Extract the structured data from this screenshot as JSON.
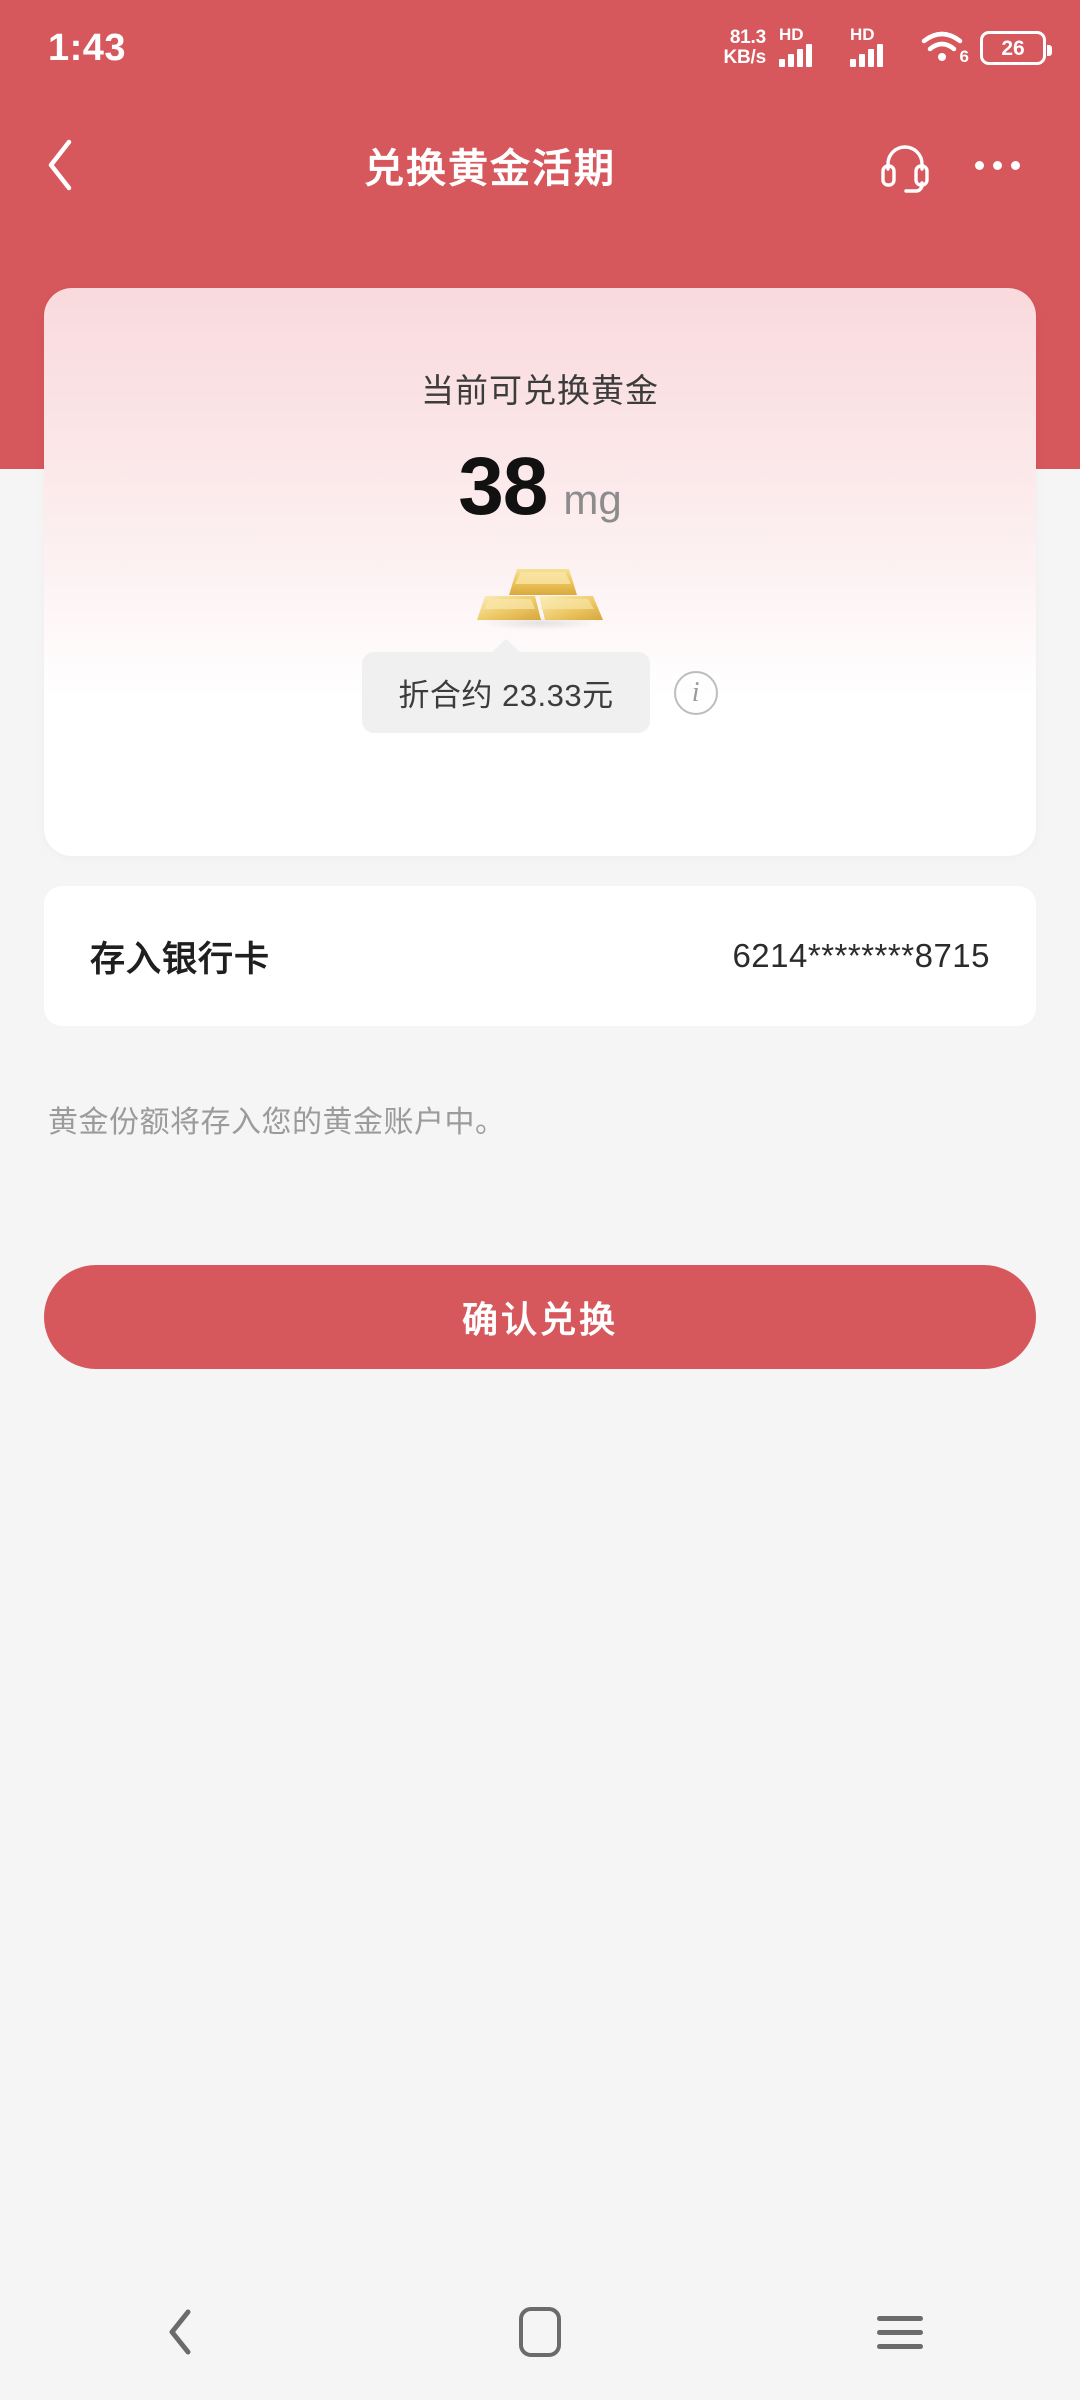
{
  "status_bar": {
    "clock": "1:43",
    "network_speed_value": "81.3",
    "network_speed_unit": "KB/s",
    "sim1_label": "HD",
    "sim2_label": "HD",
    "wifi_generation": "6",
    "battery_percent": "26"
  },
  "header": {
    "title": "兑换黄金活期",
    "back_icon": "chevron-left-icon",
    "support_icon": "headset-icon",
    "more_icon": "more-horizontal-icon",
    "background_color": "#d6575c"
  },
  "gold_card": {
    "label": "当前可兑换黄金",
    "amount": "38",
    "unit": "mg",
    "bars_icon": "gold-bars-icon",
    "conversion_text": "折合约 23.33元",
    "info_icon": "info-circle-icon"
  },
  "bank_row": {
    "label": "存入银行卡",
    "value": "6214********8715"
  },
  "note": "黄金份额将存入您的黄金账户中。",
  "confirm_button": {
    "label": "确认兑换",
    "color": "#d6575c"
  },
  "nav_bar": {
    "back_icon": "chevron-left-icon",
    "home_icon": "home-square-icon",
    "recents_icon": "menu-lines-icon"
  }
}
